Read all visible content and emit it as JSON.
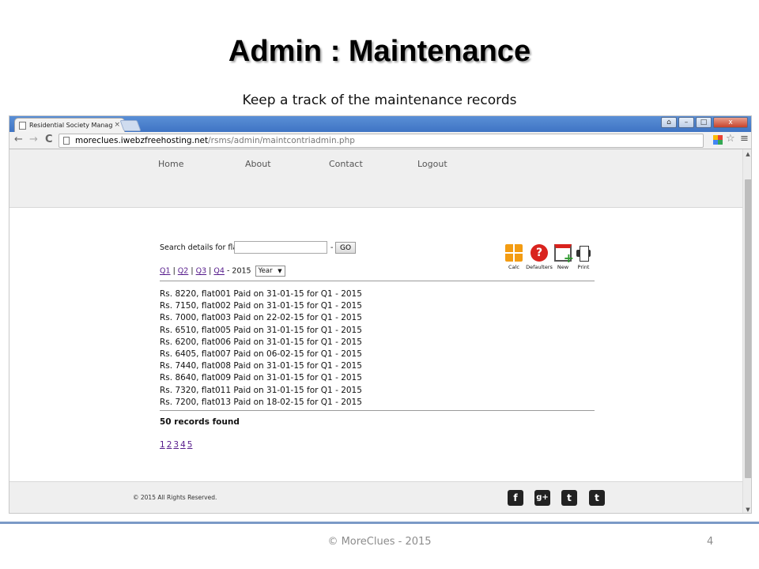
{
  "slide": {
    "title": "Admin : Maintenance",
    "subtitle": "Keep a track of the maintenance records",
    "footer": "© MoreClues - 2015",
    "page_number": "4"
  },
  "browser": {
    "tab_title": "Residential Society Manag",
    "tab_close": "×",
    "url_host": "moreclues.iwebzfreehosting.net",
    "url_path": "/rsms/admin/maintcontriadmin.php",
    "back_glyph": "←",
    "forward_glyph": "→",
    "reload_glyph": "C",
    "star_glyph": "☆",
    "menu_glyph": "≡",
    "minimize_glyph": "–",
    "maximize_glyph": "□",
    "close_glyph": "x",
    "user_glyph": "⌂",
    "icons": {
      "back": "back-arrow-icon",
      "forward": "forward-arrow-icon",
      "reload": "reload-icon",
      "star": "bookmark-star-icon",
      "menu": "menu-icon",
      "extension": "extension-icon"
    }
  },
  "site": {
    "nav": [
      "Home",
      "About",
      "Contact",
      "Logout"
    ],
    "search_label": "Search details for flat:",
    "search_value": "",
    "dash": "-",
    "go_label": "GO",
    "quarters": [
      "Q1",
      "Q2",
      "Q3",
      "Q4"
    ],
    "separator": "|",
    "year_suffix": "- 2015",
    "year_select": "Year",
    "year_arrow": "▼",
    "tools": [
      {
        "label": "Calc",
        "icon": "calculator-icon"
      },
      {
        "label": "Defaulters",
        "icon": "question-icon"
      },
      {
        "label": "New",
        "icon": "calendar-add-icon"
      },
      {
        "label": "Print",
        "icon": "printer-icon"
      }
    ],
    "defaulters_glyph": "?",
    "records": [
      "Rs. 8220, flat001 Paid on 31-01-15 for Q1 - 2015",
      "Rs. 7150, flat002 Paid on 31-01-15 for Q1 - 2015",
      "Rs. 7000, flat003 Paid on 22-02-15 for Q1 - 2015",
      "Rs. 6510, flat005 Paid on 31-01-15 for Q1 - 2015",
      "Rs. 6200, flat006 Paid on 31-01-15 for Q1 - 2015",
      "Rs. 6405, flat007 Paid on 06-02-15 for Q1 - 2015",
      "Rs. 7440, flat008 Paid on 31-01-15 for Q1 - 2015",
      "Rs. 8640, flat009 Paid on 31-01-15 for Q1 - 2015",
      "Rs. 7320, flat011 Paid on 31-01-15 for Q1 - 2015",
      "Rs. 7200, flat013 Paid on 18-02-15 for Q1 - 2015"
    ],
    "records_found": "50 records found",
    "pages": [
      "1",
      "2",
      "3",
      "4",
      "5"
    ],
    "copyright": "© 2015 All Rights Reserved.",
    "social": [
      {
        "glyph": "f",
        "icon": "facebook-icon"
      },
      {
        "glyph": "g+",
        "icon": "google-plus-icon"
      },
      {
        "glyph": "t",
        "icon": "twitter-icon"
      },
      {
        "glyph": "t",
        "icon": "tumblr-icon"
      }
    ],
    "colors": {
      "link_visited": "#551a8b",
      "calc_orange": "#f39c12",
      "defaulters_red": "#d9231e",
      "new_green": "#2e9b2e",
      "chrome_blue": "#3f74c4"
    }
  }
}
